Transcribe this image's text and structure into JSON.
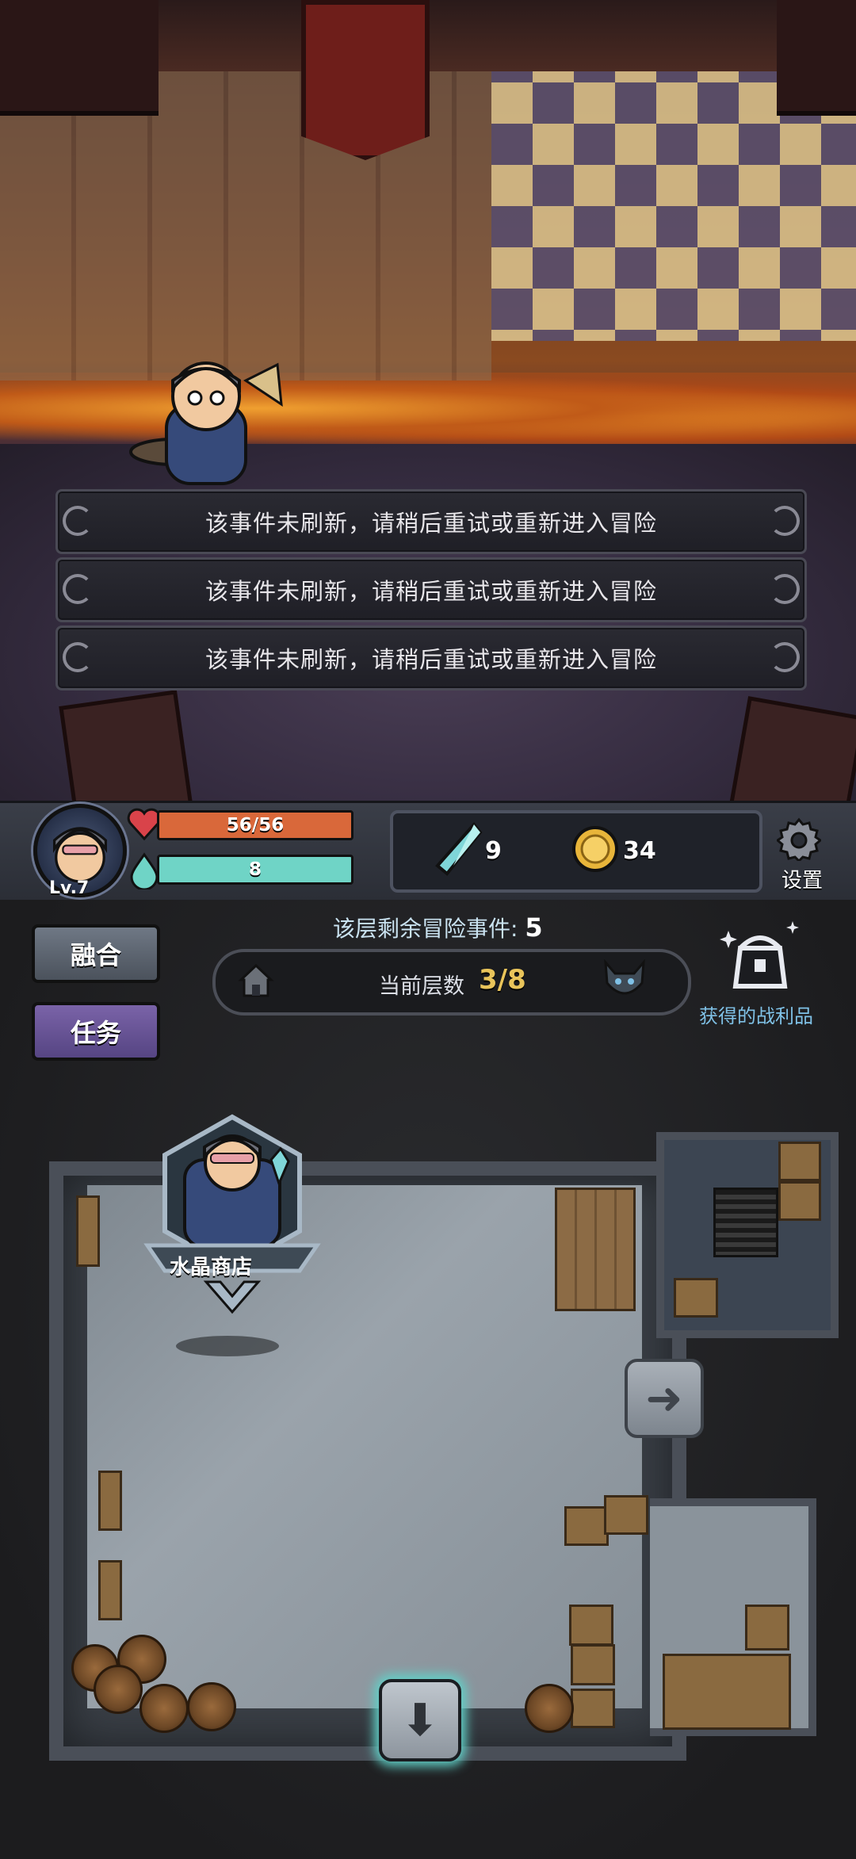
{
  "scene": {
    "events": [
      "该事件未刷新，请稍后重试或重新进入冒险",
      "该事件未刷新，请稍后重试或重新进入冒险",
      "该事件未刷新，请稍后重试或重新进入冒险"
    ]
  },
  "player": {
    "level": "Lv.7",
    "hp": "56/56",
    "hp_fraction": 1.0,
    "mana": "8",
    "mana_fraction": 1.0
  },
  "resources": {
    "crystals": "9",
    "coins": "34"
  },
  "settings_label": "设置",
  "side_buttons": {
    "fuse": "融合",
    "quests": "任务"
  },
  "floor_info": {
    "remaining_label": "该层剩余冒险事件:",
    "remaining_value": "5",
    "current_floor_label": "当前层数",
    "current_floor_value": "3/8"
  },
  "loot_label": "获得的战利品",
  "map": {
    "shop_label": "水晶商店"
  },
  "colors": {
    "hp_fill": "#d9683a",
    "mana_fill": "#6fd4c6",
    "floor_value": "#e9c45a",
    "loot_text": "#7fc1e6",
    "glow": "#62d1c8"
  }
}
